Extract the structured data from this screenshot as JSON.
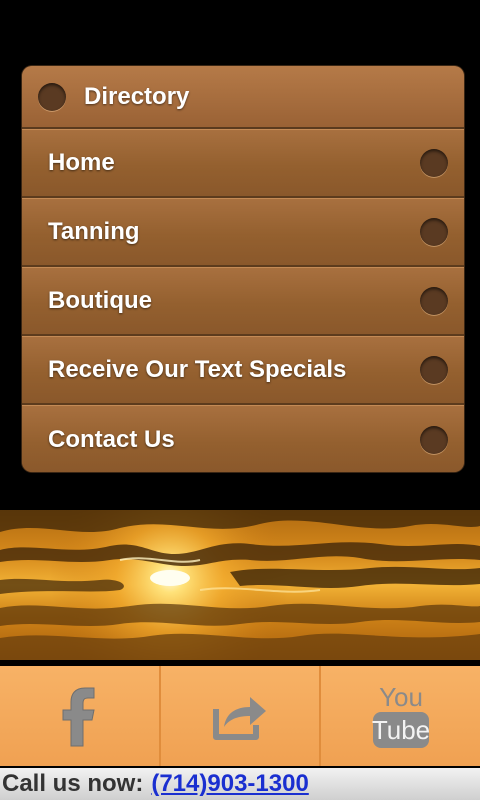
{
  "directory": {
    "title": "Directory",
    "items": [
      {
        "label": "Home"
      },
      {
        "label": "Tanning"
      },
      {
        "label": "Boutique"
      },
      {
        "label": "Receive Our Text Specials"
      },
      {
        "label": "Contact Us"
      }
    ]
  },
  "social": {
    "buttons": [
      {
        "icon": "facebook-icon"
      },
      {
        "icon": "share-icon"
      },
      {
        "icon": "youtube-icon",
        "text_top": "You",
        "text_bottom": "Tube"
      }
    ]
  },
  "call": {
    "label": "Call us now:",
    "phone": "(714)903-1300"
  },
  "colors": {
    "menu_brown": "#9a6235",
    "social_orange": "#f0a152",
    "link_blue": "#1a2fd0"
  }
}
